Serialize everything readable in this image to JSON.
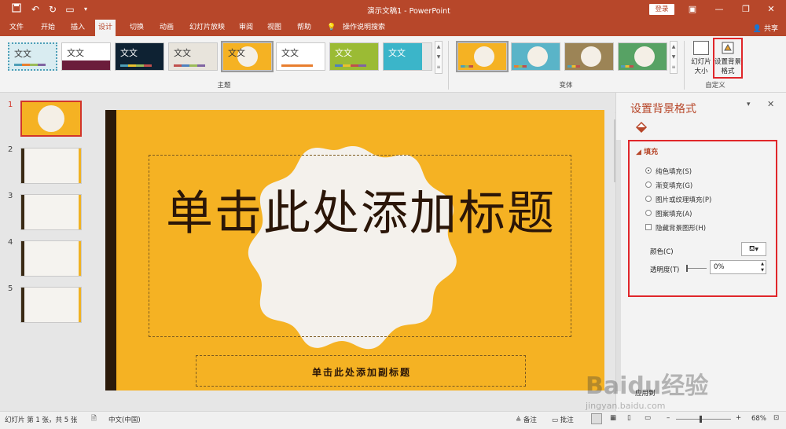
{
  "titlebar": {
    "doc_title": "演示文稿1  -  PowerPoint",
    "login": "登录",
    "icons": [
      "save-icon",
      "undo-icon",
      "redo-icon",
      "start-from-beginning-icon",
      "customize-icon"
    ]
  },
  "menu": {
    "tabs": [
      "文件",
      "开始",
      "插入",
      "设计",
      "切换",
      "动画",
      "幻灯片放映",
      "审阅",
      "视图",
      "帮助",
      "操作说明搜索"
    ],
    "active": "设计",
    "share": "共享"
  },
  "ribbon": {
    "themes_label": "主题",
    "variants_label": "变体",
    "customize_label": "自定义",
    "theme_text": "文文",
    "slide_size": "幻灯片大小",
    "format_background": "设置背景格式"
  },
  "thumbnails": {
    "numbers": [
      "1",
      "2",
      "3",
      "4",
      "5"
    ]
  },
  "slide": {
    "title": "单击此处添加标题",
    "subtitle": "单击此处添加副标题"
  },
  "pane": {
    "title": "设置背景格式",
    "section": "填充",
    "options": {
      "solid": "纯色填充(S)",
      "gradient": "渐变填充(G)",
      "picture": "图片或纹理填充(P)",
      "pattern": "图案填充(A)",
      "hide_graphics": "隐藏背景图形(H)"
    },
    "color_label": "颜色(C)",
    "transparency_label": "透明度(T)",
    "transparency_value": "0%",
    "apply_all": "应用到"
  },
  "status": {
    "slide_info": "幻灯片 第 1 张，共 5 张",
    "language": "中文(中国)",
    "notes": "备注",
    "comments": "批注",
    "zoom": "68%"
  },
  "colors": {
    "accent": "#b7472a",
    "slide_bg": "#f5b223",
    "highlight": "#e0262a"
  },
  "watermark": {
    "text": "Baidu经验",
    "url": "jingyan.baidu.com"
  }
}
